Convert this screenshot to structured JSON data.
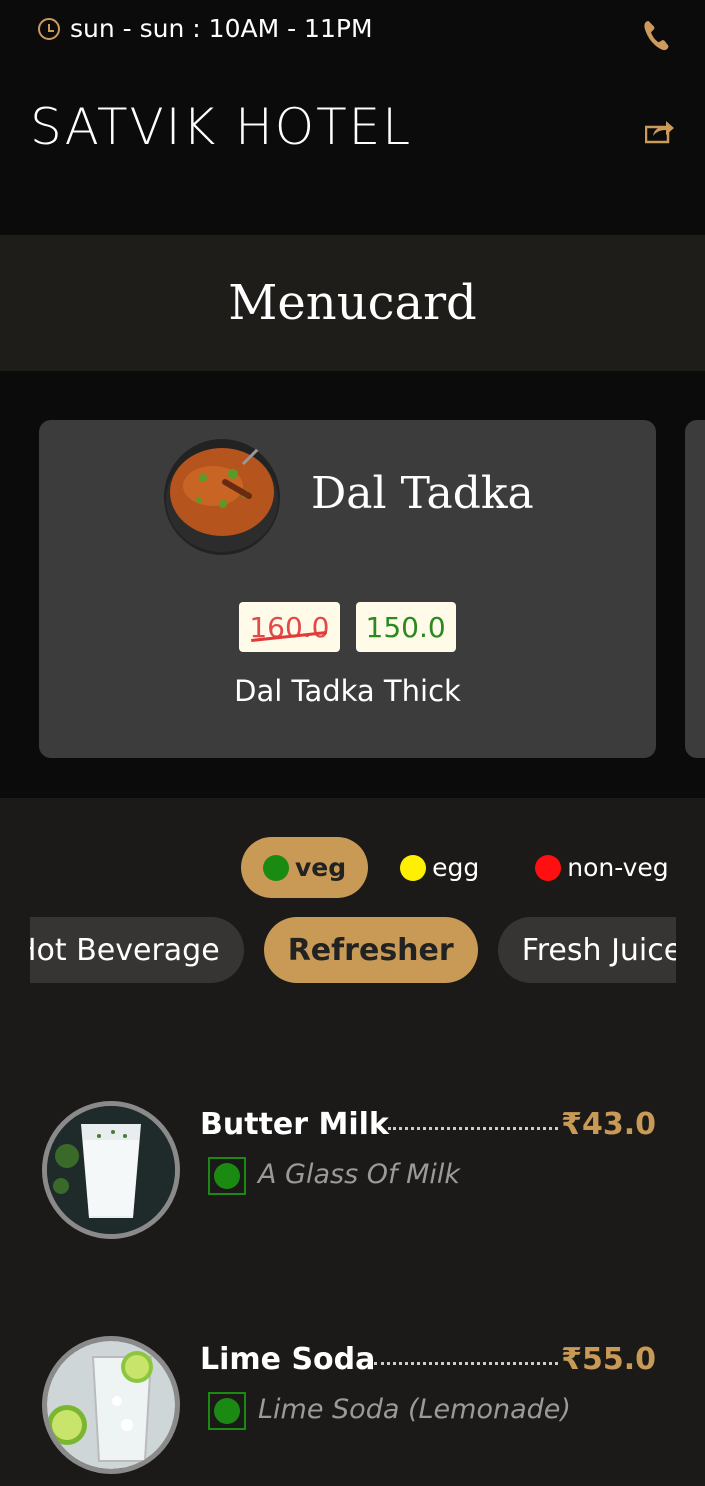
{
  "header": {
    "hours": "sun - sun : 10AM - 11PM",
    "title": "SATVIK HOTEL"
  },
  "menu_band": {
    "title": "Menucard"
  },
  "featured": {
    "name": "Dal Tadka",
    "old_price": "160.0",
    "new_price": "150.0",
    "description": "Dal Tadka Thick"
  },
  "filters": {
    "veg": "veg",
    "egg": "egg",
    "nonveg": "non-veg",
    "active": "veg"
  },
  "categories": [
    {
      "label": "Hot Beverage"
    },
    {
      "label": "Refresher",
      "active": true
    },
    {
      "label": "Fresh Juices"
    }
  ],
  "items": [
    {
      "name": "Butter Milk",
      "price": "₹43.0",
      "description": "A Glass Of Milk",
      "type": "veg"
    },
    {
      "name": "Lime Soda",
      "price": "₹55.0",
      "description": "Lime Soda (Lemonade)",
      "type": "veg"
    }
  ],
  "colors": {
    "accent": "#c99a56",
    "background": "#0b0b0b",
    "card": "#3c3c3c",
    "veg": "#1a8a12",
    "egg": "#fff000",
    "nonveg": "#ff1010"
  }
}
